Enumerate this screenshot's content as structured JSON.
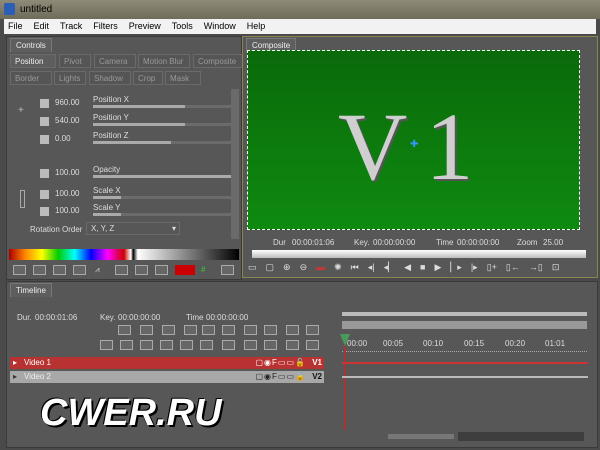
{
  "window": {
    "title": "untitled"
  },
  "menu": [
    "File",
    "Edit",
    "Track",
    "Filters",
    "Preview",
    "Tools",
    "Window",
    "Help"
  ],
  "controls": {
    "title": "Controls",
    "tabs_row1": [
      "Position",
      "Pivot",
      "Camera",
      "Motion Blur",
      "Composite"
    ],
    "tabs_row2": [
      "Border",
      "Lights",
      "Shadow",
      "Crop",
      "Mask"
    ],
    "active_tab": "Position",
    "params": [
      {
        "label": "Position X",
        "value": "960.00",
        "level": 0.65
      },
      {
        "label": "Position Y",
        "value": "540.00",
        "level": 0.65
      },
      {
        "label": "Position Z",
        "value": "0.00",
        "level": 0.55
      },
      {
        "label": "Opacity",
        "value": "100.00",
        "level": 1.0
      },
      {
        "label": "Scale X",
        "value": "100.00",
        "level": 0.2
      },
      {
        "label": "Scale Y",
        "value": "100.00",
        "level": 0.2
      }
    ],
    "rotation_order_label": "Rotation Order",
    "rotation_order_value": "X, Y, Z"
  },
  "composite": {
    "title": "Composite",
    "preview_text": "V1",
    "dur_label": "Dur",
    "dur": "00:00:01:06",
    "key_label": "Key.",
    "key": "00:00:00:00",
    "time_label": "Time",
    "time": "00:00:00:00",
    "zoom_label": "Zoom",
    "zoom": "25.00",
    "preview_color": "#0e8a10"
  },
  "timeline": {
    "title": "Timeline",
    "dur_label": "Dur.",
    "dur": "00:00:01:06",
    "key_label": "Key.",
    "key": "00:00:00:00",
    "time_label": "Time",
    "time": "00:00:00:00",
    "ruler": [
      "00:00",
      "00:05",
      "00:10",
      "00:15",
      "00:20",
      "01:01"
    ],
    "tracks": [
      {
        "name": "Video 1",
        "tag": "V1",
        "color": "#b83232",
        "selected": true
      },
      {
        "name": "Video 2",
        "tag": "V2",
        "color": "#a8a8a8",
        "selected": false
      }
    ]
  },
  "watermark": "CWER.RU"
}
